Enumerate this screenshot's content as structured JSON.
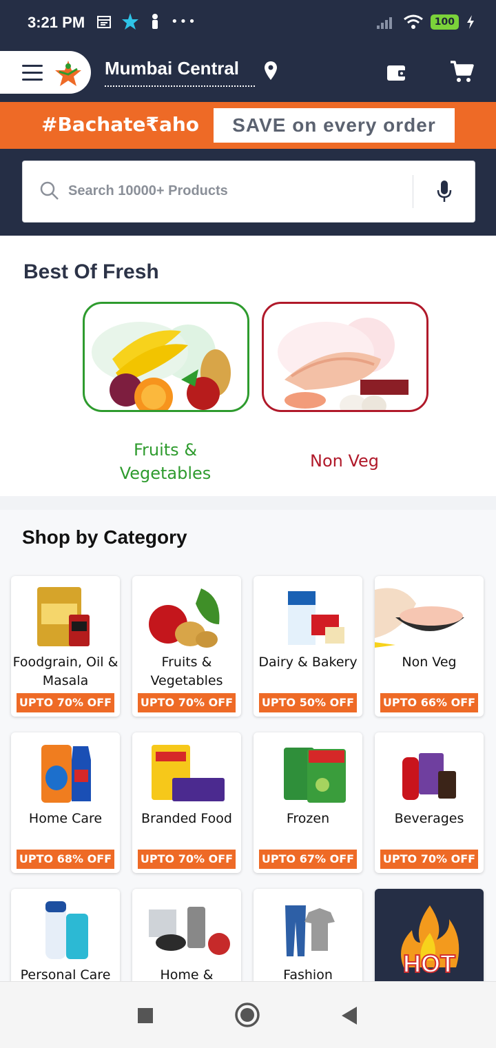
{
  "status_bar": {
    "time": "3:21 PM",
    "battery": "100",
    "more": "•••"
  },
  "header": {
    "location": "Mumbai Central"
  },
  "promo": {
    "tag": "#Bachate₹aho",
    "save_text": "SAVE on every order"
  },
  "search": {
    "placeholder": "Search 10000+ Products"
  },
  "fresh": {
    "title": "Best Of Fresh",
    "items": [
      {
        "label": "Fruits & Vegetables",
        "color": "#2e9b2e"
      },
      {
        "label": "Non Veg",
        "color": "#b0192a"
      }
    ]
  },
  "category": {
    "title": "Shop by Category",
    "tiles": [
      {
        "name": "Foodgrain, Oil & Masala",
        "offer": "UPTO 70% OFF"
      },
      {
        "name": "Fruits & Vegetables",
        "offer": "UPTO 70% OFF"
      },
      {
        "name": "Dairy & Bakery",
        "offer": "UPTO 50% OFF"
      },
      {
        "name": "Non Veg",
        "offer": "UPTO 66% OFF"
      },
      {
        "name": "Home Care",
        "offer": "UPTO 68% OFF"
      },
      {
        "name": "Branded Food",
        "offer": "UPTO 70% OFF"
      },
      {
        "name": "Frozen",
        "offer": "UPTO 67% OFF"
      },
      {
        "name": "Beverages",
        "offer": "UPTO 70% OFF"
      },
      {
        "name": "Personal Care",
        "offer": ""
      },
      {
        "name": "Home &",
        "offer": ""
      },
      {
        "name": "Fashion",
        "offer": ""
      },
      {
        "name": "HOT",
        "offer": ""
      }
    ]
  },
  "colors": {
    "navy": "#252e45",
    "orange": "#ee6a26",
    "green": "#2e9b2e",
    "red": "#b0192a"
  }
}
